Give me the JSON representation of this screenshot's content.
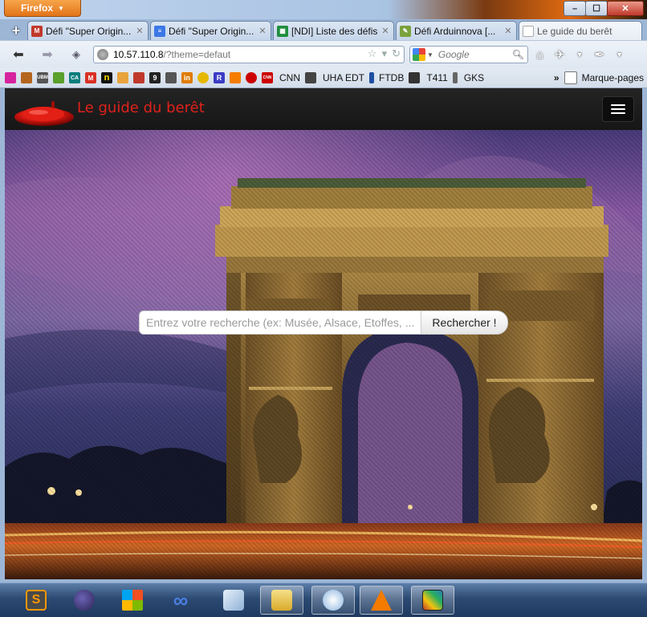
{
  "browser": {
    "app_button": "Firefox",
    "window_controls": {
      "minimize": "–",
      "maximize": "☐",
      "close": "✕"
    },
    "tabs": [
      {
        "label": "Défi \"Super Origin...",
        "icon": "gmail-icon",
        "color": "#c0392b",
        "active": false
      },
      {
        "label": "Défi \"Super Origin...",
        "icon": "docs-icon",
        "color": "#3b78e7",
        "active": false
      },
      {
        "label": "[NDI] Liste des défis",
        "icon": "sheets-icon",
        "color": "#1e8e3e",
        "active": false
      },
      {
        "label": "Défi Arduinnova [...",
        "icon": "page-icon",
        "color": "#7aa23b",
        "active": false
      },
      {
        "label": "Le guide du berêt",
        "icon": "blank-page-icon",
        "color": "#cccccc",
        "active": true
      }
    ],
    "url_host": "10.57.110.8",
    "url_path": "/?theme=defaut",
    "search_engine": "Google",
    "bookmarks": [
      {
        "label": "",
        "icon": "instagram-icon",
        "color": "#d6249f"
      },
      {
        "label": "",
        "icon": "mascot-icon",
        "color": "#b5651d"
      },
      {
        "label": "",
        "icon": "ubm-icon",
        "text": "UBM",
        "color": "#555555"
      },
      {
        "label": "",
        "icon": "puzzle-icon",
        "color": "#5aa02c"
      },
      {
        "label": "",
        "icon": "ca-icon",
        "text": "CA",
        "color": "#0a7d7d"
      },
      {
        "label": "",
        "icon": "gmail-icon",
        "color": "#d93025"
      },
      {
        "label": "",
        "icon": "n-icon",
        "text": "n",
        "color": "#111111"
      },
      {
        "label": "",
        "icon": "slack-icon",
        "color": "#e8a33c"
      },
      {
        "label": "",
        "icon": "calendar-icon",
        "color": "#c0392b"
      },
      {
        "label": "",
        "icon": "nine-icon",
        "text": "9",
        "color": "#222222"
      },
      {
        "label": "",
        "icon": "cup-icon",
        "color": "#555555"
      },
      {
        "label": "",
        "icon": "in-icon",
        "text": "in",
        "color": "#e07b00"
      },
      {
        "label": "",
        "icon": "smiley-icon",
        "color": "#e6b800"
      },
      {
        "label": "",
        "icon": "r-icon",
        "text": "R",
        "color": "#3b3bc4"
      },
      {
        "label": "",
        "icon": "blogger-icon",
        "color": "#f57d00"
      },
      {
        "label": "",
        "icon": "spiral-icon",
        "color": "#cc0000"
      },
      {
        "label": "CNN",
        "icon": "cnn-icon",
        "text": "CNN",
        "color": "#cc0000"
      },
      {
        "label": "UHA EDT",
        "icon": "uha-icon",
        "color": "#444444"
      },
      {
        "label": "FTDB",
        "icon": "ftdb-icon",
        "color": "#1f4fa0"
      },
      {
        "label": "T411",
        "icon": "t411-icon",
        "color": "#333333"
      },
      {
        "label": "GKS",
        "icon": "gks-icon",
        "color": "#666666"
      }
    ],
    "bookmarks_more": "»",
    "bookmarks_menu": "Marque-pages"
  },
  "site": {
    "title": "Le guide du berêt",
    "title_color": "#e0211b",
    "search_placeholder": "Entrez votre recherche (ex: Musée, Alsace, Etoffes, ...",
    "search_button": "Rechercher !"
  },
  "taskbar": {
    "apps": [
      {
        "icon": "sublime-text-icon",
        "color": "#ff9800",
        "open": false
      },
      {
        "icon": "eclipse-icon",
        "color": "#2c2255",
        "open": false
      },
      {
        "icon": "windows-logo-icon",
        "color": "#e74c3c",
        "open": false
      },
      {
        "icon": "infinity-icon",
        "color": "#2f5cc5",
        "open": false
      },
      {
        "icon": "cube-icon",
        "color": "#9ab8d8",
        "open": false
      },
      {
        "icon": "file-explorer-icon",
        "color": "#e8c34a",
        "open": true
      },
      {
        "icon": "cat-icon",
        "color": "#6aa0d8",
        "open": true
      },
      {
        "icon": "vlc-icon",
        "color": "#f47b00",
        "open": true
      },
      {
        "icon": "paint-icon",
        "color": "#c0392b",
        "open": true
      }
    ]
  }
}
